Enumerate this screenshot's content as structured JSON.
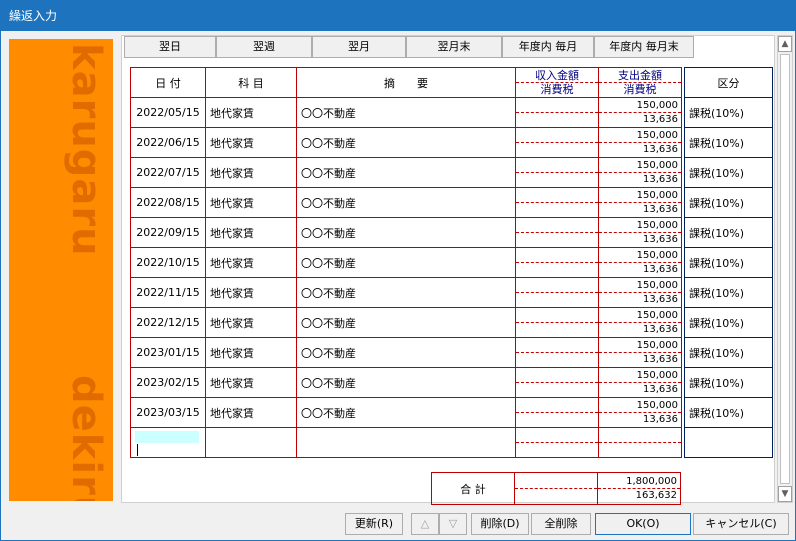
{
  "window": {
    "title": "繰返入力"
  },
  "side_texts": [
    "karugaru",
    "dekiru"
  ],
  "nav_buttons": [
    "翌日",
    "翌週",
    "翌月",
    "翌月末",
    "年度内 毎月",
    "年度内 毎月末"
  ],
  "columns": {
    "date": "日 付",
    "account": "科 目",
    "memo": "摘　　要",
    "income_top": "収入金額",
    "income_bot": "消費税",
    "expense_top": "支出金額",
    "expense_bot": "消費税",
    "kubun": "区分"
  },
  "rows": [
    {
      "date": "2022/05/15",
      "account": "地代家賃",
      "memo": "〇〇不動産",
      "expense": "150,000",
      "tax": "13,636",
      "kubun": "課税(10%)"
    },
    {
      "date": "2022/06/15",
      "account": "地代家賃",
      "memo": "〇〇不動産",
      "expense": "150,000",
      "tax": "13,636",
      "kubun": "課税(10%)"
    },
    {
      "date": "2022/07/15",
      "account": "地代家賃",
      "memo": "〇〇不動産",
      "expense": "150,000",
      "tax": "13,636",
      "kubun": "課税(10%)"
    },
    {
      "date": "2022/08/15",
      "account": "地代家賃",
      "memo": "〇〇不動産",
      "expense": "150,000",
      "tax": "13,636",
      "kubun": "課税(10%)"
    },
    {
      "date": "2022/09/15",
      "account": "地代家賃",
      "memo": "〇〇不動産",
      "expense": "150,000",
      "tax": "13,636",
      "kubun": "課税(10%)"
    },
    {
      "date": "2022/10/15",
      "account": "地代家賃",
      "memo": "〇〇不動産",
      "expense": "150,000",
      "tax": "13,636",
      "kubun": "課税(10%)"
    },
    {
      "date": "2022/11/15",
      "account": "地代家賃",
      "memo": "〇〇不動産",
      "expense": "150,000",
      "tax": "13,636",
      "kubun": "課税(10%)"
    },
    {
      "date": "2022/12/15",
      "account": "地代家賃",
      "memo": "〇〇不動産",
      "expense": "150,000",
      "tax": "13,636",
      "kubun": "課税(10%)"
    },
    {
      "date": "2023/01/15",
      "account": "地代家賃",
      "memo": "〇〇不動産",
      "expense": "150,000",
      "tax": "13,636",
      "kubun": "課税(10%)"
    },
    {
      "date": "2023/02/15",
      "account": "地代家賃",
      "memo": "〇〇不動産",
      "expense": "150,000",
      "tax": "13,636",
      "kubun": "課税(10%)"
    },
    {
      "date": "2023/03/15",
      "account": "地代家賃",
      "memo": "〇〇不動産",
      "expense": "150,000",
      "tax": "13,636",
      "kubun": "課税(10%)"
    }
  ],
  "totals": {
    "label": "合 計",
    "expense": "1,800,000",
    "tax": "163,632"
  },
  "footer": {
    "update": "更新(R)",
    "up": "△",
    "down": "▽",
    "delete": "削除(D)",
    "delete_all": "全削除",
    "ok": "OK(O)",
    "cancel": "キャンセル(C)"
  },
  "scroll_up": "▲",
  "scroll_down": "▼"
}
